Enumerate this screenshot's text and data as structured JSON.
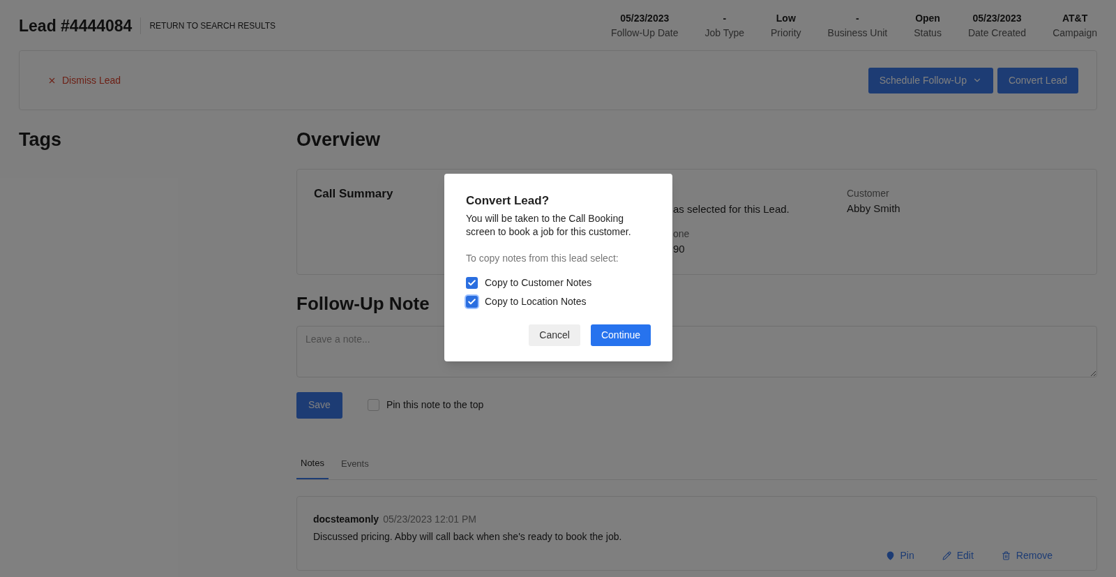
{
  "header": {
    "title": "Lead #4444084",
    "return_link": "RETURN TO SEARCH RESULTS",
    "meta": [
      {
        "value": "05/23/2023",
        "label": "Follow-Up Date"
      },
      {
        "value": "-",
        "label": "Job Type"
      },
      {
        "value": "Low",
        "label": "Priority"
      },
      {
        "value": "-",
        "label": "Business Unit"
      },
      {
        "value": "Open",
        "label": "Status"
      },
      {
        "value": "05/23/2023",
        "label": "Date Created"
      },
      {
        "value": "AT&T",
        "label": "Campaign"
      }
    ]
  },
  "actions": {
    "dismiss": "Dismiss Lead",
    "schedule": "Schedule Follow-Up",
    "convert": "Convert Lead"
  },
  "tags": {
    "title": "Tags"
  },
  "overview": {
    "title": "Overview",
    "call_summary": {
      "title": "Call Summary",
      "fragment_text": "as selected for this Lead.",
      "fragment_label": "one",
      "fragment_value": "90",
      "customer_label": "Customer",
      "customer_value": "Abby Smith"
    }
  },
  "follow_up": {
    "title": "Follow-Up Note",
    "placeholder": "Leave a note...",
    "save": "Save",
    "pin": {
      "label": "Pin this note to the top",
      "checked": false
    }
  },
  "tabs": [
    {
      "label": "Notes",
      "selected": true
    },
    {
      "label": "Events",
      "selected": false
    }
  ],
  "notes": [
    {
      "author": "docsteamonly",
      "time": "05/23/2023 12:01 PM",
      "text": "Discussed pricing. Abby will call back when she's ready to book the job.",
      "actions": [
        {
          "kind": "pin",
          "label": "Pin"
        },
        {
          "kind": "edit",
          "label": "Edit"
        },
        {
          "kind": "remove",
          "label": "Remove"
        }
      ]
    }
  ],
  "modal": {
    "title": "Convert Lead?",
    "body": "You will be taken to the Call Booking screen to book a job for this customer.",
    "prompt": "To copy notes from this lead select:",
    "options": [
      {
        "label": "Copy to Customer Notes",
        "checked": true,
        "focused": false
      },
      {
        "label": "Copy to Location Notes",
        "checked": true,
        "focused": true
      }
    ],
    "cancel": "Cancel",
    "continue": "Continue"
  }
}
